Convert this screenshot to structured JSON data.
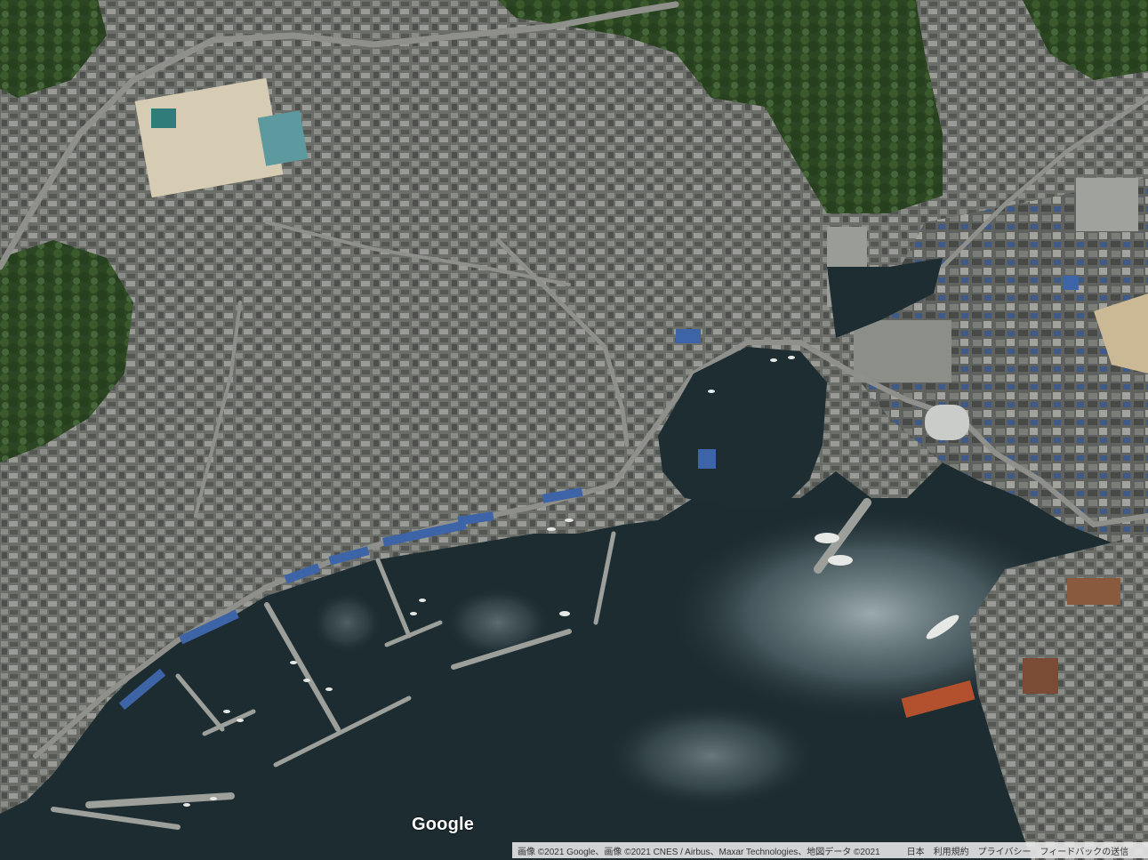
{
  "map": {
    "view": "satellite",
    "colors": {
      "water": "#1f2e33",
      "water_glare": "#8fa1a6",
      "urban": "#6b6d68",
      "forest": "#2f4a24",
      "field": "#d7cdb4",
      "road": "#8a8a86"
    }
  },
  "branding": {
    "logo_text": "Google"
  },
  "attribution": {
    "imagery": "画像 ©2021 Google、画像 ©2021 CNES / Airbus、Maxar Technologies、地図データ ©2021",
    "country": "日本",
    "terms": "利用規約",
    "privacy": "プライバシー",
    "feedback": "フィードバックの送信"
  }
}
